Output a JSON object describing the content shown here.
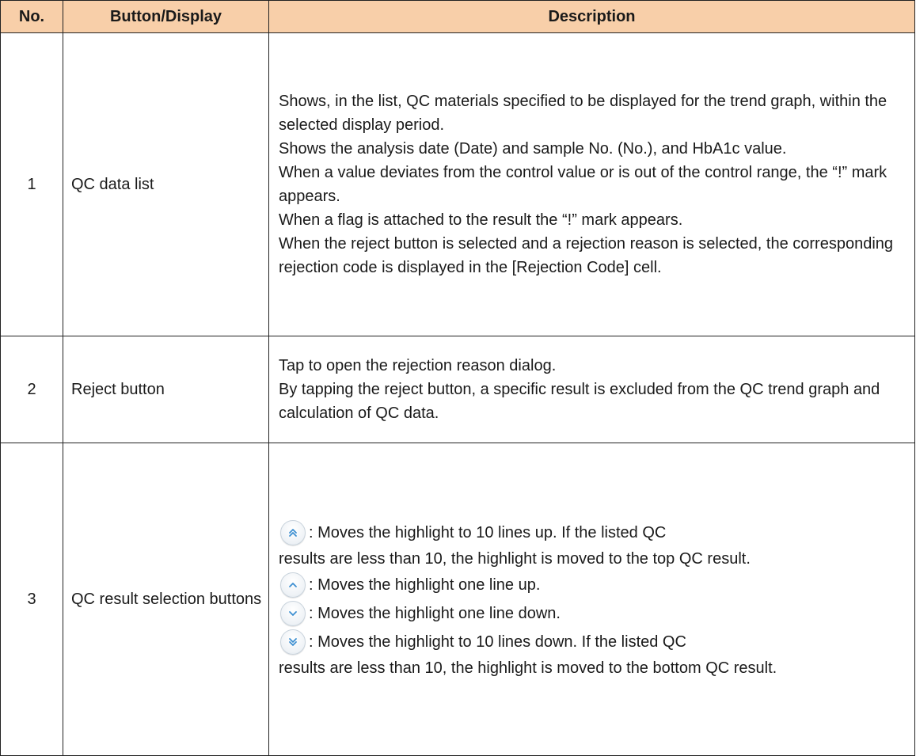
{
  "header": {
    "no": "No.",
    "button": "Button/Display",
    "description": "Description"
  },
  "rows": [
    {
      "no": "1",
      "name": "QC data list",
      "lines": [
        "Shows, in the list, QC materials specified to be displayed for the trend graph, within the selected display period.",
        "Shows the analysis date (Date) and sample No. (No.), and HbA1c value.",
        "When a value deviates from the control value or is out of the control range, the “!” mark appears.",
        "When a flag is attached to the result the “!” mark appears.",
        "When the reject button is selected and a rejection reason is selected, the corresponding rejection code is displayed in the [Rejection Code] cell."
      ]
    },
    {
      "no": "2",
      "name": "Reject button",
      "lines": [
        "Tap to open the rejection reason dialog.",
        "By tapping the reject button, a specific result is excluded from the QC trend graph and calculation of QC data."
      ]
    },
    {
      "no": "3",
      "name": "QC result selection buttons",
      "items": [
        {
          "icon": "double-chevron-up-icon",
          "text": ": Moves the highlight to 10 lines up. If the listed QC",
          "cont": "results are less than 10, the highlight is moved to the top QC result."
        },
        {
          "icon": "chevron-up-icon",
          "text": ": Moves the highlight one line up."
        },
        {
          "icon": "chevron-down-icon",
          "text": ": Moves the highlight one line down."
        },
        {
          "icon": "double-chevron-down-icon",
          "text": ": Moves the highlight to 10 lines down. If the listed QC",
          "cont": "results are less than 10, the highlight is moved to the bottom QC result."
        }
      ]
    }
  ],
  "colors": {
    "header_bg": "#f8cfa9",
    "icon_blue": "#3d8fd1",
    "border": "#222222"
  }
}
